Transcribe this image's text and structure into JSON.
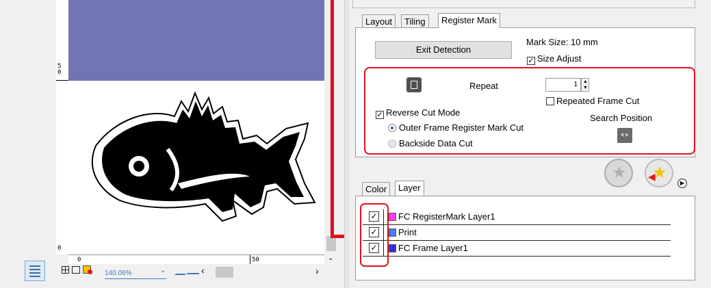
{
  "canvas": {
    "ruler_v_labels": [
      "5",
      "0",
      "0"
    ],
    "ruler_h_labels": [
      "0",
      "50"
    ],
    "zoom": "140.06%",
    "fill_color": "#7075b3"
  },
  "tabs": {
    "items": [
      "Layout",
      "Tiling",
      "Register Mark"
    ],
    "active": "Register Mark"
  },
  "register_mark": {
    "exit_label": "Exit Detection",
    "mark_size": "Mark Size: 10 mm",
    "size_adjust": "Size Adjust",
    "size_adjust_checked": true,
    "repeat_label": "Repeat",
    "repeat_value": "1",
    "repeated_frame_cut": "Repeated Frame Cut",
    "repeated_frame_cut_checked": false,
    "reverse_cut_mode": "Reverse Cut Mode",
    "reverse_cut_mode_checked": true,
    "outer_frame": "Outer Frame Register Mark Cut",
    "backside": "Backside Data Cut",
    "search_position": "Search Position"
  },
  "layer_tabs": {
    "items": [
      "Color",
      "Layer"
    ],
    "active": "Layer"
  },
  "layers": [
    {
      "name": "FC RegisterMark Layer1",
      "color": "#ff40ff",
      "checked": "✓"
    },
    {
      "name": "Print",
      "color": "#3f7fff",
      "checked": "✓"
    },
    {
      "name": "FC Frame Layer1",
      "color": "#3030e0",
      "checked": "✓"
    }
  ],
  "annotation_color": "#e0101c"
}
